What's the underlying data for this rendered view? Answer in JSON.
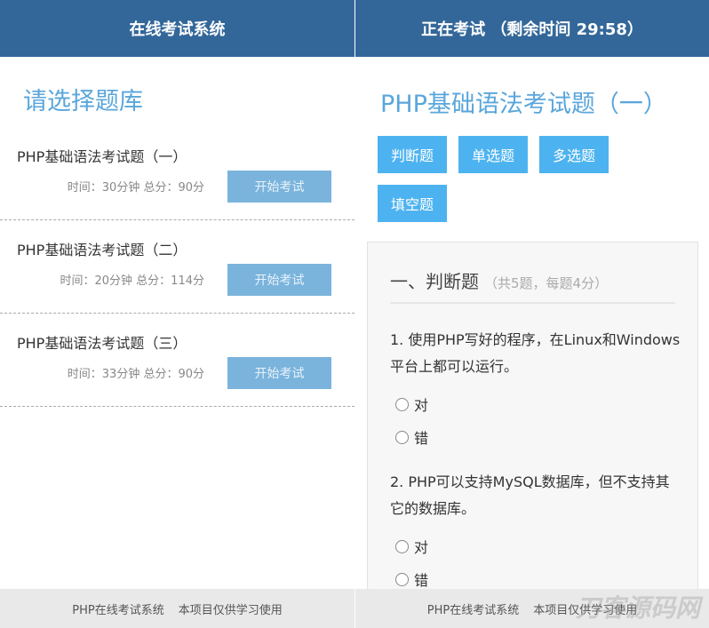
{
  "left": {
    "header": "在线考试系统",
    "title": "请选择题库",
    "exams": [
      {
        "name": "PHP基础语法考试题（一）",
        "info": "时间：30分钟 总分：90分",
        "button": "开始考试"
      },
      {
        "name": "PHP基础语法考试题（二）",
        "info": "时间：20分钟 总分：114分",
        "button": "开始考试"
      },
      {
        "name": "PHP基础语法考试题（三）",
        "info": "时间：33分钟 总分：90分",
        "button": "开始考试"
      }
    ]
  },
  "right": {
    "header": "正在考试 （剩余时间 29:58）",
    "title": "PHP基础语法考试题（一）",
    "tabs": [
      "判断题",
      "单选题",
      "多选题",
      "填空题"
    ],
    "section": {
      "title": "一、判断题",
      "note": "（共5题，每题4分）"
    },
    "questions": [
      {
        "text": "1. 使用PHP写好的程序，在Linux和Windows平台上都可以运行。",
        "options": [
          "对",
          "错"
        ]
      },
      {
        "text": "2. PHP可以支持MySQL数据库，但不支持其它的数据库。",
        "options": [
          "对",
          "错"
        ]
      }
    ]
  },
  "footer": {
    "name": "PHP在线考试系统",
    "note": "本项目仅供学习使用"
  },
  "watermark": "刀客源码网",
  "colors": {
    "header": "#336799",
    "accent": "#5aa6db",
    "tab": "#4db3f0",
    "button": "#7ab4dc"
  }
}
